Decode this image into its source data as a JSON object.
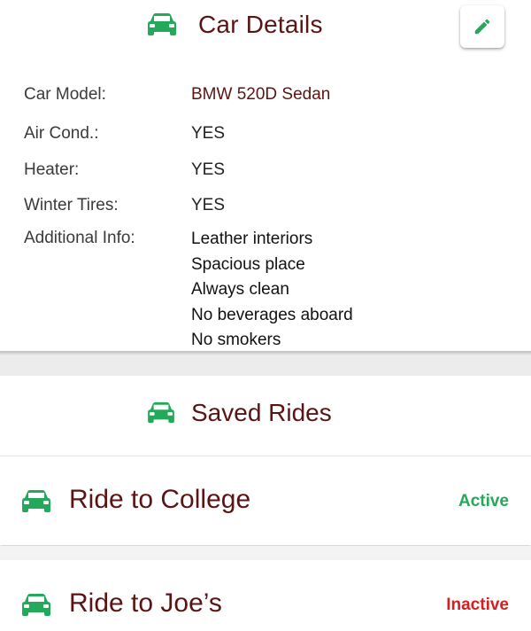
{
  "colors": {
    "accent_green": "#24a85a",
    "title_maroon": "#5b1414",
    "status_active": "#24a85a",
    "status_inactive": "#d42020"
  },
  "car_details": {
    "icon": "car-icon",
    "title": "Car Details",
    "edit_icon": "pencil-icon",
    "rows": [
      {
        "label": "Car Model:",
        "value": "BMW 520D Sedan"
      },
      {
        "label": "Air Cond.:",
        "value": "YES"
      },
      {
        "label": "Heater:",
        "value": "YES"
      },
      {
        "label": "Winter Tires:",
        "value": "YES"
      }
    ],
    "additional_info": {
      "label": "Additional Info:",
      "lines": [
        "Leather interiors",
        "Spacious place",
        "Always clean",
        "No beverages aboard",
        "No smokers"
      ]
    }
  },
  "saved_rides": {
    "icon": "car-icon",
    "title": "Saved Rides",
    "items": [
      {
        "icon": "car-icon",
        "title": "Ride to College",
        "status": "Active"
      },
      {
        "icon": "car-icon",
        "title": "Ride to Joe’s",
        "status": "Inactive"
      }
    ]
  }
}
